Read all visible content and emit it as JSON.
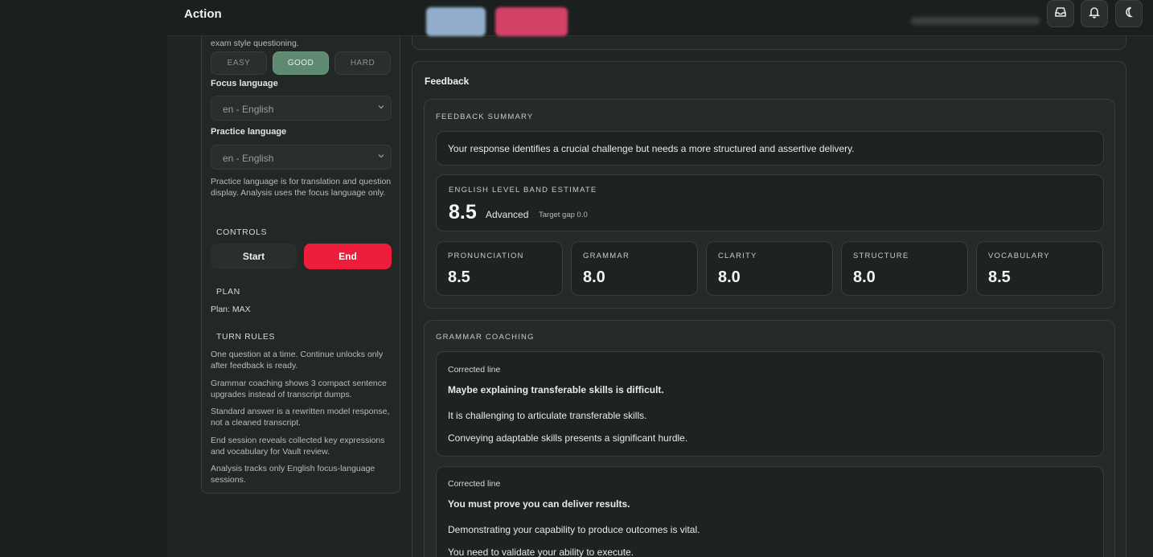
{
  "header": {
    "title": "Action"
  },
  "left_panel": {
    "partial_text": "exam style questioning.",
    "difficulty": [
      {
        "label": "EASY",
        "active": false
      },
      {
        "label": "GOOD",
        "active": true
      },
      {
        "label": "HARD",
        "active": false
      }
    ],
    "focus_language_label": "Focus language",
    "focus_language_value": "en - English",
    "practice_language_label": "Practice language",
    "practice_language_value": "en - English",
    "practice_note": "Practice language is for translation and question display. Analysis uses the focus language only.",
    "controls_heading": "CONTROLS",
    "start_label": "Start",
    "end_label": "End",
    "plan_heading": "PLAN",
    "plan_value": "Plan: MAX",
    "turn_rules_heading": "TURN RULES",
    "turn_rules": [
      "One question at a time. Continue unlocks only after feedback is ready.",
      "Grammar coaching shows 3 compact sentence upgrades instead of transcript dumps.",
      "Standard answer is a rewritten model response, not a cleaned transcript.",
      "End session reveals collected key expressions and vocabulary for Vault review.",
      "Analysis tracks only English focus-language sessions."
    ]
  },
  "feedback": {
    "title": "Feedback",
    "summary_heading": "FEEDBACK SUMMARY",
    "summary_text": "Your response identifies a crucial challenge but needs a more structured and assertive delivery.",
    "band_heading": "ENGLISH LEVEL BAND ESTIMATE",
    "band_score": "8.5",
    "band_level": "Advanced",
    "band_gap": "Target gap 0.0",
    "metrics": [
      {
        "label": "PRONUNCIATION",
        "value": "8.5"
      },
      {
        "label": "GRAMMAR",
        "value": "8.0"
      },
      {
        "label": "CLARITY",
        "value": "8.0"
      },
      {
        "label": "STRUCTURE",
        "value": "8.0"
      },
      {
        "label": "VOCABULARY",
        "value": "8.5"
      }
    ],
    "grammar_heading": "GRAMMAR COACHING",
    "corrections": [
      {
        "label": "Corrected line",
        "original": "Maybe explaining transferable skills is difficult.",
        "upgrades": [
          "It is challenging to articulate transferable skills.",
          "Conveying adaptable skills presents a significant hurdle."
        ]
      },
      {
        "label": "Corrected line",
        "original": "You must prove you can deliver results.",
        "upgrades": [
          "Demonstrating your capability to produce outcomes is vital.",
          "You need to validate your ability to execute."
        ]
      }
    ]
  }
}
